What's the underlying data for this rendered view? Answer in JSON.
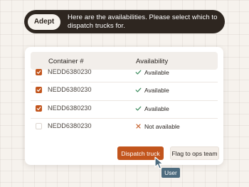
{
  "banner": {
    "agent_label": "Adept",
    "message": "Here are the availabilities. Please select which to dispatch trucks for."
  },
  "table": {
    "headers": {
      "container": "Container #",
      "availability": "Availability"
    },
    "rows": [
      {
        "container": "NEDD6380230",
        "checked": true,
        "status": "Available",
        "status_icon": "check-icon"
      },
      {
        "container": "NEDD6380230",
        "checked": true,
        "status": "Available",
        "status_icon": "check-icon"
      },
      {
        "container": "NEDD6380230",
        "checked": true,
        "status": "Available",
        "status_icon": "check-icon"
      },
      {
        "container": "NEDD6380230",
        "checked": false,
        "status": "Not available",
        "status_icon": "x-icon"
      }
    ]
  },
  "actions": {
    "dispatch_label": "Dispatch truck",
    "flag_label": "Flag to ops team"
  },
  "cursor": {
    "label": "User",
    "icon": "pointer-cursor-icon"
  },
  "colors": {
    "accent": "#c2551d",
    "banner_bg": "#2e2620",
    "check_green": "#3a8a5c",
    "x_orange": "#c2551d",
    "user_tag": "#4d6b7e"
  }
}
